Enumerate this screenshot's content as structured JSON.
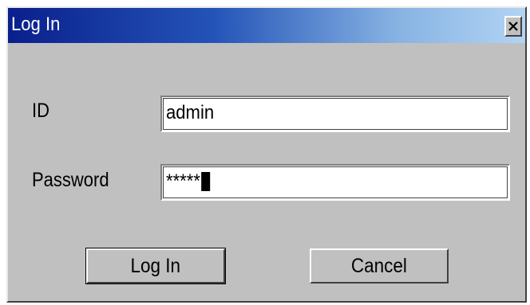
{
  "dialog": {
    "title": "Log In",
    "close_icon": "close-icon"
  },
  "form": {
    "id_label": "ID",
    "id_value": "admin",
    "password_label": "Password",
    "password_value": "*****"
  },
  "buttons": {
    "login_label": "Log In",
    "cancel_label": "Cancel"
  },
  "colors": {
    "title_gradient_start": "#0a1f8c",
    "title_gradient_end": "#b2d4f4",
    "dialog_face": "#c0c0c0"
  }
}
